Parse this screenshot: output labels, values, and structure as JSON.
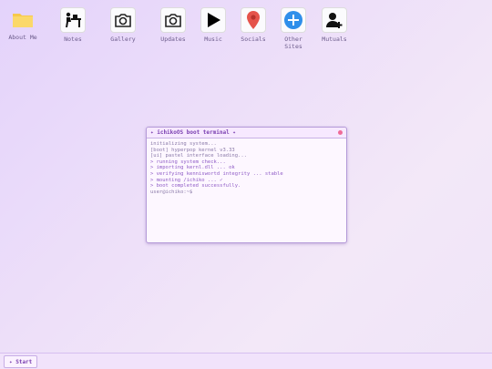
{
  "desktop": {
    "icons": [
      {
        "label": "About Me",
        "icon": "folder-icon"
      },
      {
        "label": "Notes",
        "icon": "desk-icon"
      },
      {
        "label": "Gallery",
        "icon": "camera-icon"
      },
      {
        "label": "Updates",
        "icon": "camera-icon"
      },
      {
        "label": "Music",
        "icon": "play-icon"
      },
      {
        "label": "Socials",
        "icon": "map-pin-icon"
      },
      {
        "label": "Other\nSites",
        "icon": "plus-circle-icon"
      },
      {
        "label": "Mutuals",
        "icon": "add-user-icon"
      }
    ]
  },
  "terminal": {
    "title": "✦ ichikoOS boot terminal ✦",
    "lines": [
      "initializing system...",
      "[boot] hyperpop kernel v3.33",
      "[ui] pastel interface loading...",
      "> running system check...",
      "> importing kernl.dll ... ok",
      "> verifying kenniswortd integrity ... stable",
      "> mounting /ichiko ... ✓",
      "> boot completed successfully.",
      "user@ichiko:~$"
    ]
  },
  "taskbar": {
    "start_label": "✦ Start"
  }
}
